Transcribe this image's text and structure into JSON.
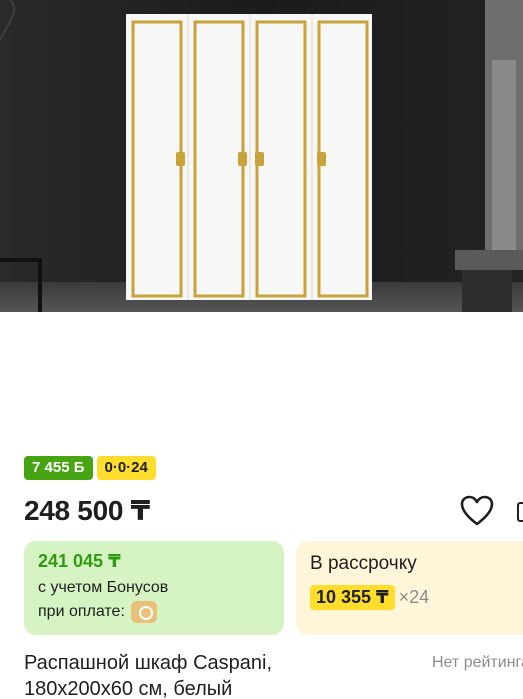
{
  "badges": {
    "bonus": "7 455 Б",
    "installment": "0·0·24"
  },
  "price": "248 500 ₸",
  "bonus_card": {
    "price": "241 045 ₸",
    "line1": "с учетом Бонусов",
    "line2": "при оплате:",
    "icon": "kaspi-icon"
  },
  "installment_card": {
    "title": "В рассрочку",
    "amount": "10 355 ₸",
    "multiplier": "×24"
  },
  "product": {
    "title": "Распашной шкаф Caspani, 180х200х60 см, белый",
    "rating": "Нет рейтинга"
  },
  "colors": {
    "bonus_green": "#47a413",
    "installment_yellow": "#ffdd2d",
    "gold_trim": "#c8a23a"
  },
  "icons": {
    "favorite": "heart-icon",
    "compare": "compare-icon"
  }
}
